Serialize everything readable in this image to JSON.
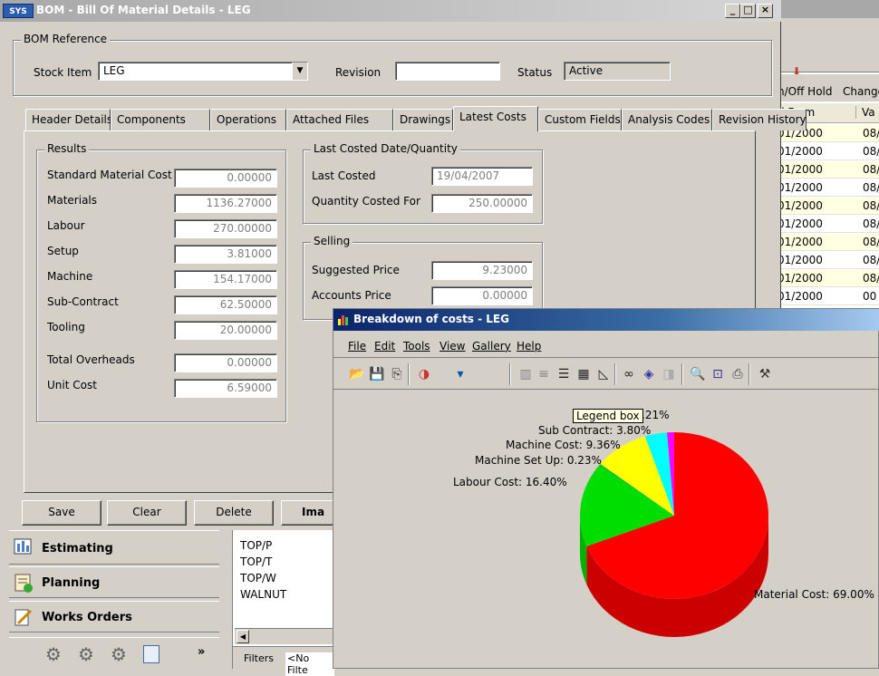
{
  "bom_window": {
    "app_badge": "SYS",
    "title": "BOM - Bill Of Material Details - LEG",
    "reference_group": "BOM Reference",
    "stock_item_label": "Stock Item",
    "stock_item_value": "LEG",
    "revision_label": "Revision",
    "revision_value": "",
    "status_label": "Status",
    "status_value": "Active",
    "tabs": [
      {
        "label": "Header Details"
      },
      {
        "label": "Components"
      },
      {
        "label": "Operations"
      },
      {
        "label": "Attached Files"
      },
      {
        "label": "Drawings"
      },
      {
        "label": "Latest Costs",
        "active": true
      },
      {
        "label": "Custom Fields"
      },
      {
        "label": "Analysis Codes"
      },
      {
        "label": "Revision History"
      }
    ],
    "results": {
      "title": "Results",
      "rows": [
        {
          "label": "Standard Material Cost",
          "value": "0.00000"
        },
        {
          "label": "Materials",
          "value": "1136.27000"
        },
        {
          "label": "Labour",
          "value": "270.00000"
        },
        {
          "label": "Setup",
          "value": "3.81000"
        },
        {
          "label": "Machine",
          "value": "154.17000"
        },
        {
          "label": "Sub-Contract",
          "value": "62.50000"
        },
        {
          "label": "Tooling",
          "value": "20.00000"
        },
        {
          "label": "Total Overheads",
          "value": "0.00000"
        },
        {
          "label": "Unit Cost",
          "value": "6.59000"
        }
      ]
    },
    "last_costed": {
      "title": "Last Costed Date/Quantity",
      "last_costed_label": "Last Costed",
      "last_costed_value": "19/04/2007",
      "qty_label": "Quantity Costed For",
      "qty_value": "250.00000"
    },
    "selling": {
      "title": "Selling",
      "suggested_label": "Suggested Price",
      "suggested_value": "9.23000",
      "accounts_label": "Accounts Price",
      "accounts_value": "0.00000"
    },
    "buttons": {
      "save": "Save",
      "clear": "Clear",
      "delete": "Delete",
      "image": "Ima"
    }
  },
  "bg_window": {
    "hold_label": "n/Off Hold",
    "change_label": "Change",
    "col_from": "d From",
    "col_va": "Va",
    "rows": [
      {
        "from": "01/2000",
        "va": "08/"
      },
      {
        "from": "01/2000",
        "va": "08/"
      },
      {
        "from": "01/2000",
        "va": "08/"
      },
      {
        "from": "01/2000",
        "va": "08/"
      },
      {
        "from": "01/2000",
        "va": "08/"
      },
      {
        "from": "01/2000",
        "va": "08/"
      },
      {
        "from": "01/2000",
        "va": "08/"
      },
      {
        "from": "01/2000",
        "va": "08/"
      },
      {
        "from": "01/2000",
        "va": "08/"
      },
      {
        "from": "01/2000",
        "va": "00"
      }
    ]
  },
  "nav": {
    "items": [
      {
        "label": "Estimating"
      },
      {
        "label": "Planning"
      },
      {
        "label": "Works Orders"
      }
    ],
    "more": "»"
  },
  "list": {
    "items": [
      "TOP/P",
      "TOP/T",
      "TOP/W",
      "WALNUT"
    ],
    "filters_label": "Filters",
    "filters_value": "<No Filte"
  },
  "chart_window": {
    "title": "Breakdown of costs - LEG",
    "menu": [
      "File",
      "Edit",
      "Tools",
      "View",
      "Gallery",
      "Help"
    ],
    "tooltip": "Legend box",
    "toolbar_icons": [
      "open-icon",
      "save-icon",
      "copy-icon",
      "palette-icon",
      "paint-bucket-icon",
      "vertical-grid-icon",
      "horizontal-grid-icon",
      "legend-icon",
      "data-grid-icon",
      "axis-icon",
      "3d-glasses-icon",
      "rotate-icon",
      "point-labels-icon",
      "zoom-icon",
      "print-preview-icon",
      "print-icon",
      "tools-icon"
    ],
    "colors": {
      "material": "#ff0000",
      "labour": "#00dd00",
      "setup": "#00aa44",
      "machine": "#ffff00",
      "subcontract": "#00ffff",
      "tooling": "#ff00ff"
    }
  },
  "chart_data": {
    "type": "pie",
    "title": "",
    "slices": [
      {
        "name": "Material Cost",
        "value": 69.0,
        "label": "Material Cost: 69.00%",
        "color": "#ff0000"
      },
      {
        "name": "Labour Cost",
        "value": 16.4,
        "label": "Labour Cost: 16.40%",
        "color": "#00dd00"
      },
      {
        "name": "Machine Set Up",
        "value": 0.23,
        "label": "Machine Set Up: 0.23%",
        "color": "#00aa44"
      },
      {
        "name": "Machine Cost",
        "value": 9.36,
        "label": "Machine Cost: 9.36%",
        "color": "#ffff00"
      },
      {
        "name": "Sub Contract",
        "value": 3.8,
        "label": "Sub Contract: 3.80%",
        "color": "#00ffff"
      },
      {
        "name": "Tooling",
        "value": 1.21,
        "label": ".21%",
        "color": "#ff00ff"
      }
    ],
    "three_d": true,
    "legend": "none"
  }
}
